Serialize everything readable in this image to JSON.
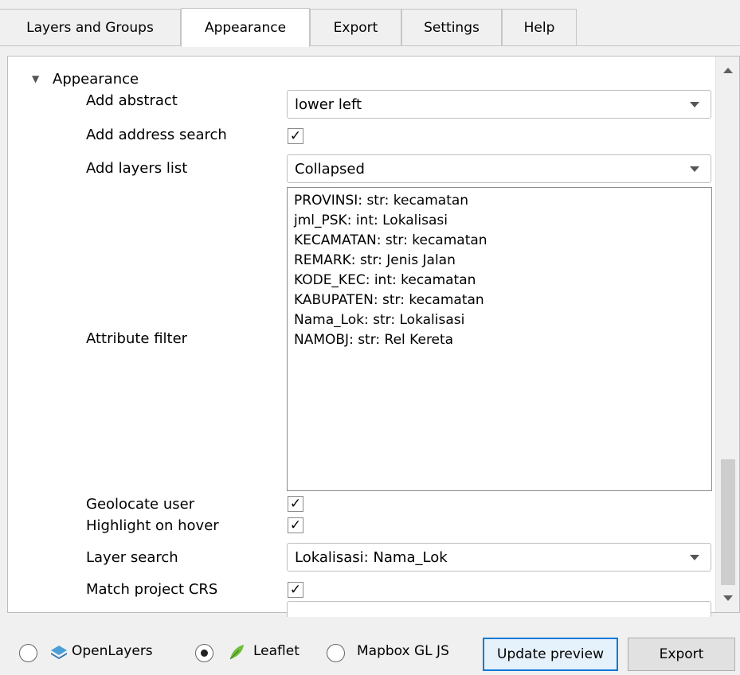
{
  "tabs": [
    {
      "label": "Layers and Groups",
      "active": false
    },
    {
      "label": "Appearance",
      "active": true
    },
    {
      "label": "Export",
      "active": false
    },
    {
      "label": "Settings",
      "active": false
    },
    {
      "label": "Help",
      "active": false
    }
  ],
  "section": {
    "title": "Appearance",
    "expanded": true
  },
  "properties": {
    "add_abstract": {
      "label": "Add abstract",
      "value": "lower left"
    },
    "add_address_search": {
      "label": "Add address search",
      "checked": true
    },
    "add_layers_list": {
      "label": "Add layers list",
      "value": "Collapsed"
    },
    "attribute_filter": {
      "label": "Attribute filter",
      "items": [
        "PROVINSI: str: kecamatan",
        "jml_PSK: int: Lokalisasi",
        "KECAMATAN: str: kecamatan",
        "REMARK: str: Jenis Jalan",
        "KODE_KEC: int: kecamatan",
        "KABUPATEN: str: kecamatan",
        "Nama_Lok: str: Lokalisasi",
        "NAMOBJ: str: Rel Kereta"
      ]
    },
    "geolocate_user": {
      "label": "Geolocate user",
      "checked": true
    },
    "highlight_on_hover": {
      "label": "Highlight on hover",
      "checked": true
    },
    "layer_search": {
      "label": "Layer search",
      "value": "Lokalisasi: Nama_Lok"
    },
    "match_project_crs": {
      "label": "Match project CRS",
      "checked": true
    }
  },
  "check_glyph": "✓",
  "bottom": {
    "libraries": [
      {
        "label": "OpenLayers",
        "selected": false,
        "icon": "openlayers-icon"
      },
      {
        "label": "Leaflet",
        "selected": true,
        "icon": "leaflet-icon"
      },
      {
        "label": "Mapbox GL JS",
        "selected": false,
        "icon": ""
      }
    ],
    "update_preview_label": "Update preview",
    "export_label": "Export"
  },
  "colors": {
    "focus_border": "#0078d7",
    "openlayers_blue": "#4a9fd8",
    "leaflet_green": "#6fbf3c"
  }
}
